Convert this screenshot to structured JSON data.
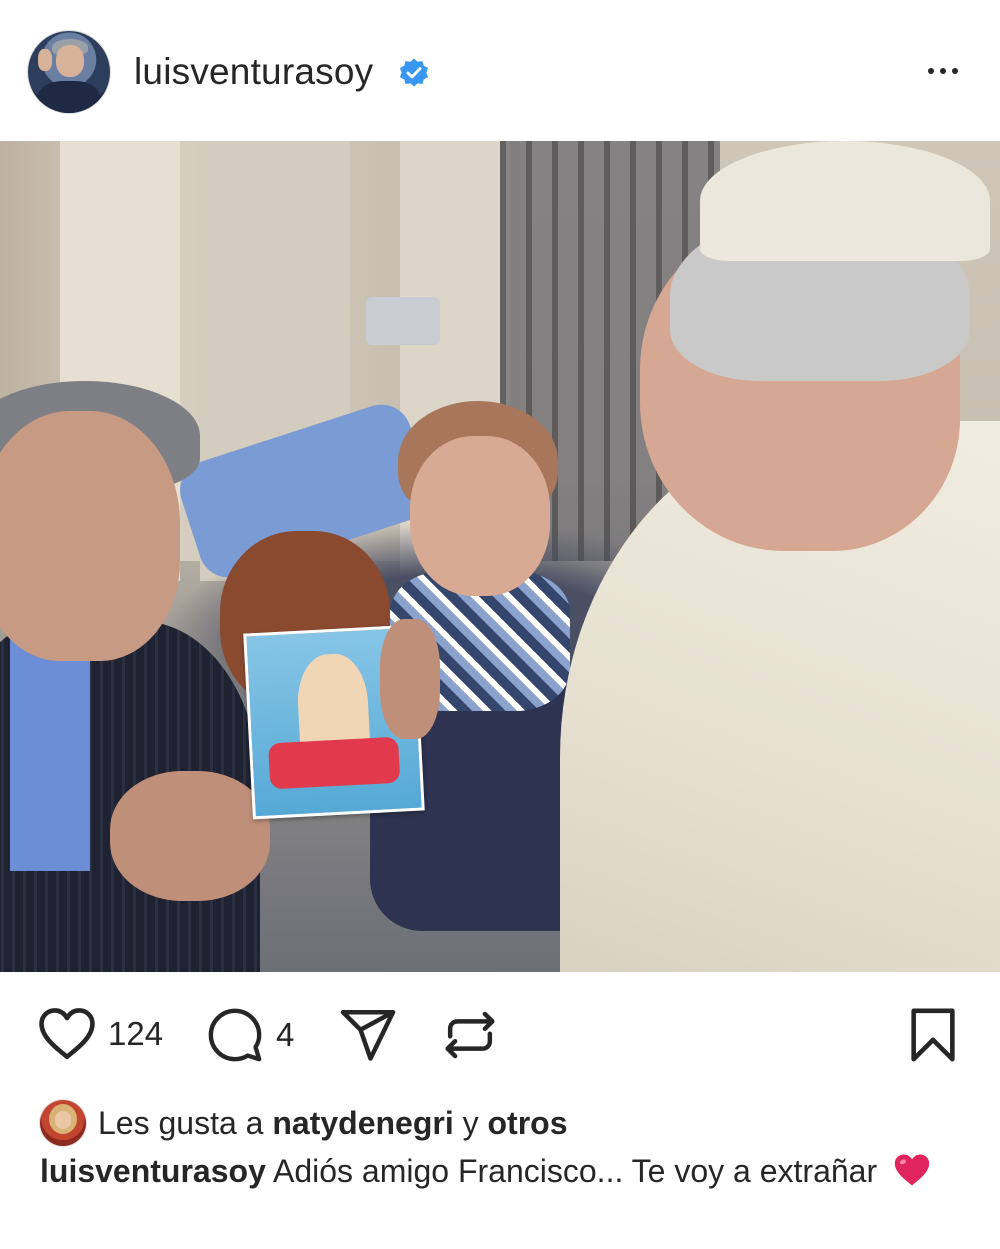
{
  "header": {
    "username": "luisventurasoy",
    "verified": true,
    "verified_color": "#3897f0",
    "more_icon": "more-horizontal-icon"
  },
  "post": {
    "image_alt_visible": false,
    "actions": {
      "like_count": "124",
      "comment_count": "4",
      "icons": [
        "heart-icon",
        "comment-icon",
        "share-icon",
        "repost-icon",
        "bookmark-icon"
      ]
    },
    "likes": {
      "prefix": "Les gusta a",
      "user": "natydenegri",
      "connector": "y",
      "others": "otros"
    },
    "caption": {
      "username": "luisventurasoy",
      "text": "Adiós amigo Francisco... Te voy a extrañar",
      "emoji": "red-heart-emoji"
    }
  },
  "colors": {
    "text": "#262626",
    "heart_emoji": "#e0245e",
    "background": "#ffffff"
  }
}
